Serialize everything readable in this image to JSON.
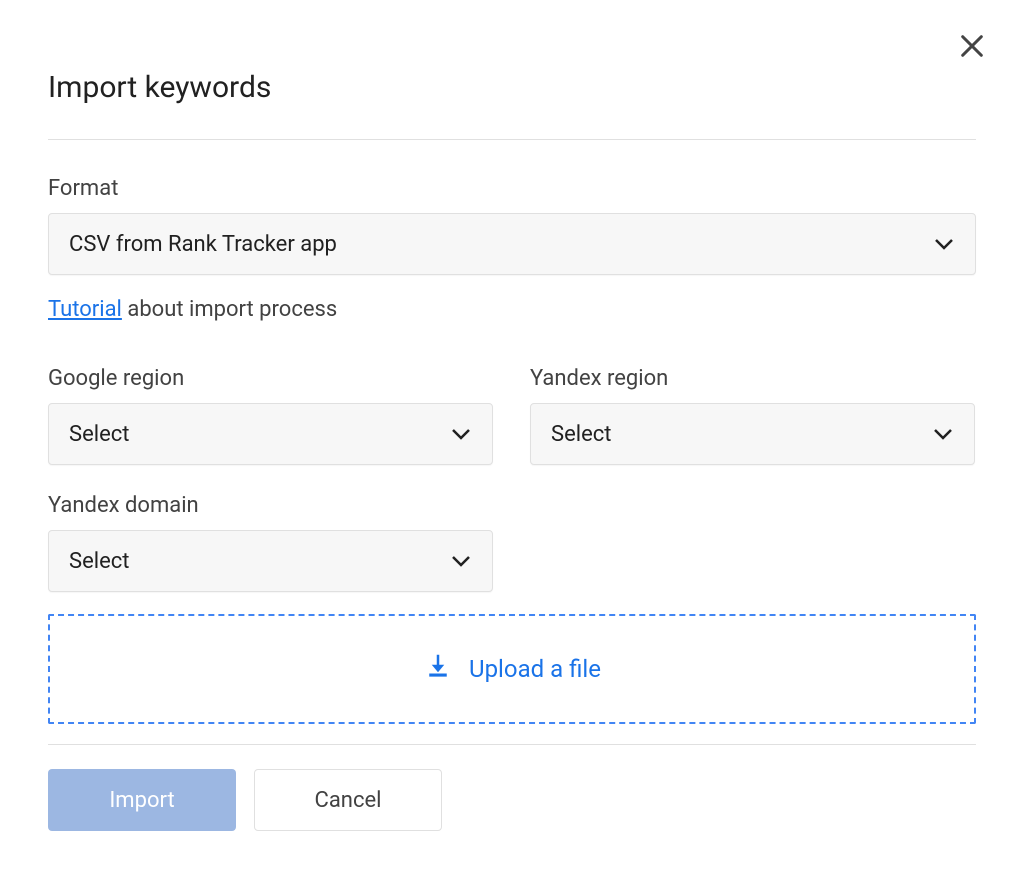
{
  "modal": {
    "title": "Import keywords",
    "format": {
      "label": "Format",
      "selected": "CSV from Rank Tracker app"
    },
    "helper": {
      "link_text": "Tutorial",
      "rest_text": " about import process"
    },
    "google_region": {
      "label": "Google region",
      "selected": "Select"
    },
    "yandex_region": {
      "label": "Yandex region",
      "selected": "Select"
    },
    "yandex_domain": {
      "label": "Yandex domain",
      "selected": "Select"
    },
    "upload": {
      "label": "Upload a file"
    },
    "buttons": {
      "import": "Import",
      "cancel": "Cancel"
    }
  }
}
